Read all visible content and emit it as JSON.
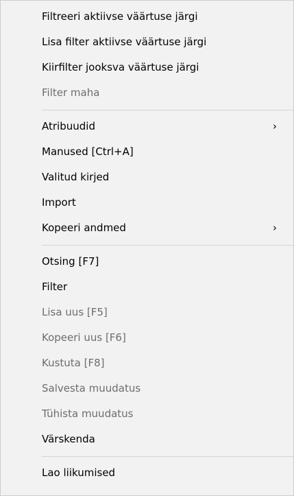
{
  "menu": {
    "groups": [
      {
        "items": [
          {
            "label": "Filtreeri aktiivse väärtuse järgi",
            "enabled": true
          },
          {
            "label": "Lisa filter aktiivse väärtuse järgi",
            "enabled": true
          },
          {
            "label": "Kiirfilter jooksva väärtuse järgi",
            "enabled": true
          },
          {
            "label": "Filter maha",
            "enabled": false
          }
        ]
      },
      {
        "items": [
          {
            "label": "Atribuudid",
            "enabled": true,
            "submenu": true
          },
          {
            "label": "Manused [Ctrl+A]",
            "enabled": true
          },
          {
            "label": "Valitud kirjed",
            "enabled": true
          },
          {
            "label": "Import",
            "enabled": true
          },
          {
            "label": "Kopeeri andmed",
            "enabled": true,
            "submenu": true
          }
        ]
      },
      {
        "items": [
          {
            "label": "Otsing [F7]",
            "enabled": true
          },
          {
            "label": "Filter",
            "enabled": true
          },
          {
            "label": "Lisa uus [F5]",
            "enabled": false
          },
          {
            "label": "Kopeeri uus [F6]",
            "enabled": false
          },
          {
            "label": "Kustuta [F8]",
            "enabled": false
          },
          {
            "label": "Salvesta muudatus",
            "enabled": false
          },
          {
            "label": "Tühista muudatus",
            "enabled": false
          },
          {
            "label": "Värskenda",
            "enabled": true
          }
        ]
      },
      {
        "items": [
          {
            "label": "Lao liikumised",
            "enabled": true
          }
        ]
      }
    ],
    "submenu_glyph": "›",
    "colors": {
      "background": "#f2f2f2",
      "text": "#000000",
      "disabled_text": "#6d6d6d",
      "separator": "#d4d4d4"
    }
  }
}
